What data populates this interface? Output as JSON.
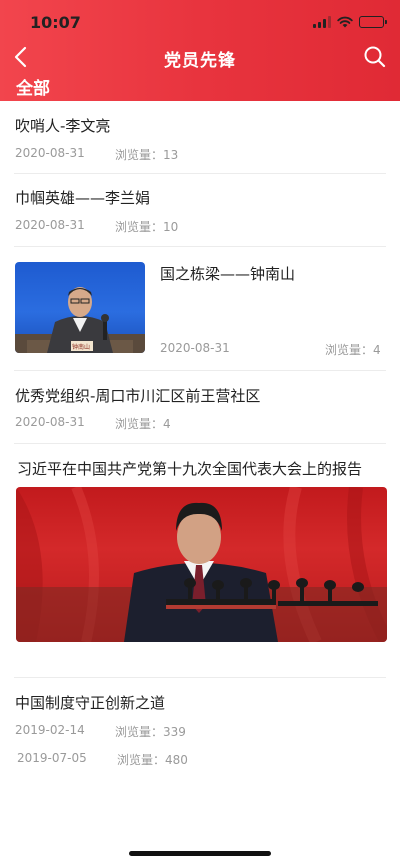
{
  "status_bar": {
    "time": "10:07"
  },
  "nav": {
    "title": "党员先锋",
    "tab_label": "全部"
  },
  "articles": [
    {
      "title": "吹哨人-李文亮",
      "date": "2020-08-31",
      "views_label": "浏览量：",
      "views": "13"
    },
    {
      "title": "巾帼英雄——李兰娟",
      "date": "2020-08-31",
      "views_label": "浏览量：",
      "views": "10"
    },
    {
      "title": "国之栋梁——钟南山",
      "date": "2020-08-31",
      "views_label": "浏览量：",
      "views": "4",
      "image_caption": "钟南山"
    },
    {
      "title": "优秀党组织-周口市川汇区前王营社区",
      "date": "2020-08-31",
      "views_label": "浏览量：",
      "views": "4"
    },
    {
      "title": "习近平在中国共产党第十九次全国代表大会上的报告",
      "date": "2019-07-05",
      "views_label": "浏览量：",
      "views": "480"
    },
    {
      "title": "中国制度守正创新之道",
      "date": "2019-02-14",
      "views_label": "浏览量：",
      "views": "339"
    }
  ],
  "colors": {
    "header_red": "#e8343e",
    "meta_gray": "#9a9a9a",
    "divider": "#ececec"
  },
  "icons": {
    "back": "chevron-left-icon",
    "search": "search-icon",
    "signal": "cellular-signal-icon",
    "wifi": "wifi-icon",
    "battery": "battery-icon"
  }
}
